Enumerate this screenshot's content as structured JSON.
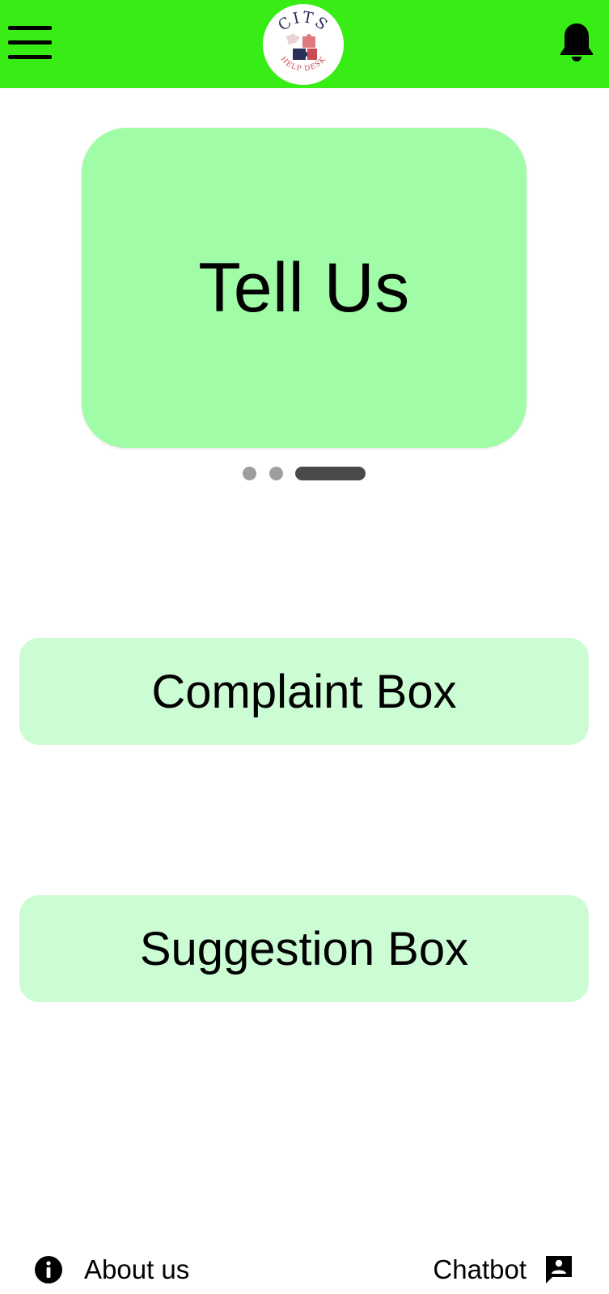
{
  "header": {
    "logo_top_text": "CITS",
    "logo_bottom_text": "HELP DESK",
    "colors": {
      "bar": "#38ec15"
    },
    "icons": {
      "left": "hamburger-menu-icon",
      "right": "bell-icon"
    }
  },
  "carousel": {
    "title": "Tell Us",
    "page_count": 3,
    "active_index": 2,
    "card_color": "#a0fca6"
  },
  "actions": {
    "complaint_label": "Complaint Box",
    "suggestion_label": "Suggestion Box",
    "box_color": "#ccfcd3"
  },
  "footer": {
    "about_label": "About us",
    "about_icon": "info-icon",
    "chat_label": "Chatbot",
    "chat_icon": "chat-person-icon"
  }
}
